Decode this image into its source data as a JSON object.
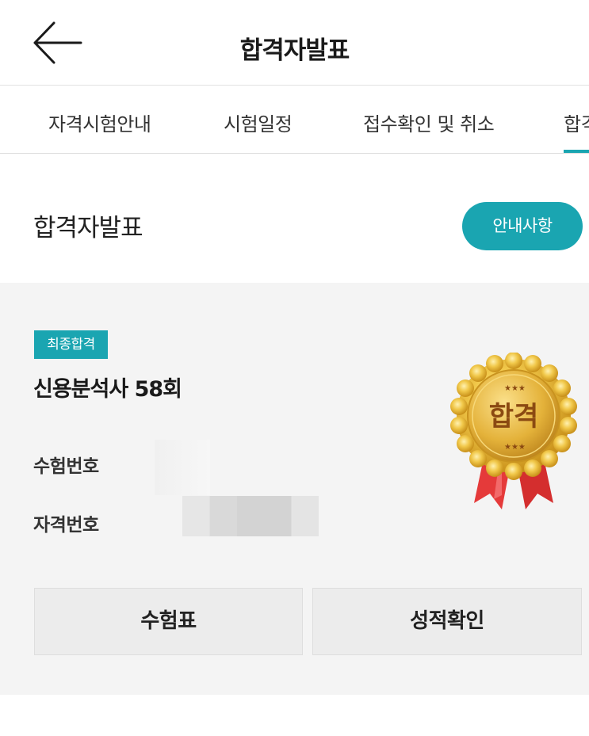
{
  "header": {
    "title": "합격자발표",
    "back_icon": "arrow-left-icon"
  },
  "tabs": [
    {
      "label": "자격시험안내"
    },
    {
      "label": "시험일정"
    },
    {
      "label": "접수확인 및 취소"
    },
    {
      "label": "합격",
      "active": true
    }
  ],
  "section": {
    "title": "합격자발표",
    "notice_button": "안내사항"
  },
  "result": {
    "badge": "최종합격",
    "exam_title": "신용분석사 58회",
    "fields": [
      {
        "label": "수험번호",
        "value": ""
      },
      {
        "label": "자격번호",
        "value": ""
      }
    ],
    "medal_text": "합격",
    "buttons": {
      "admission_ticket": "수험표",
      "score_check": "성적확인"
    }
  },
  "colors": {
    "accent": "#1aa5b1",
    "card_bg": "#f4f4f4",
    "medal_gold": "#e0ae2c",
    "ribbon_red": "#e53a3a"
  }
}
